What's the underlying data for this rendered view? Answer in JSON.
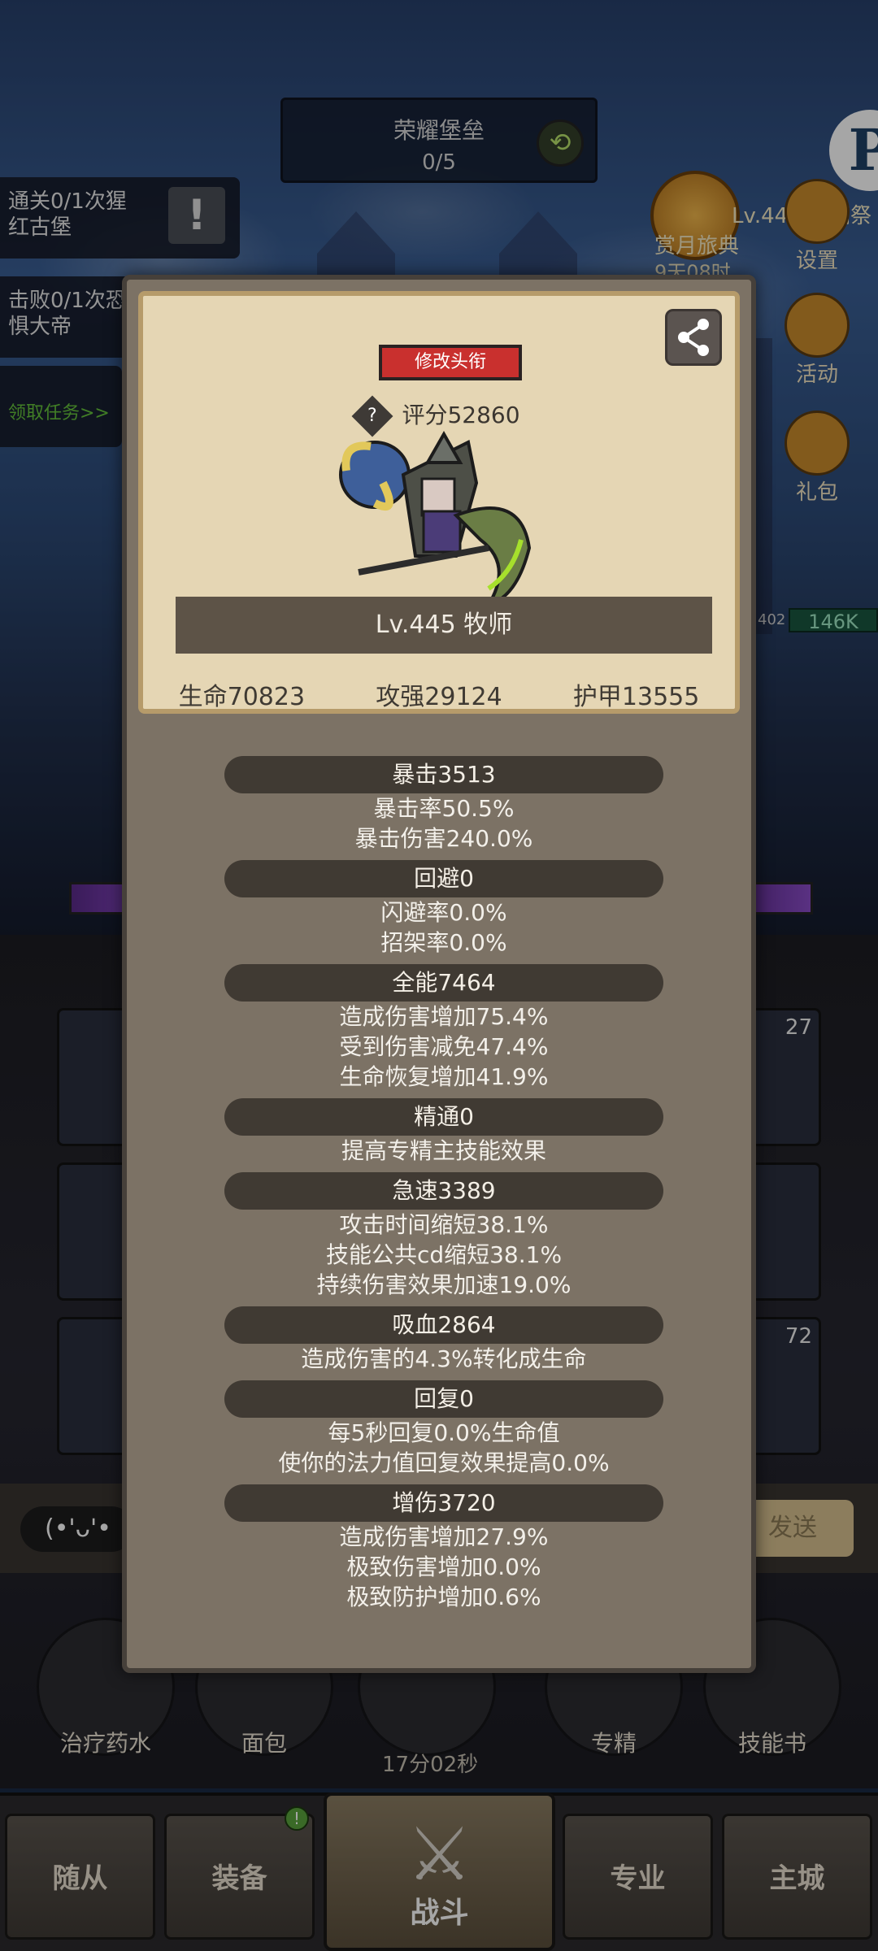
{
  "background": {
    "quest_top": {
      "title": "荣耀堡垒",
      "progress": "0/5"
    },
    "tasks": [
      {
        "line1": "通关0/1次猩",
        "line2": "红古堡"
      },
      {
        "line1": "击败0/1次恐",
        "line2": "惧大帝"
      }
    ],
    "task_link": "领取任务>>",
    "right_menu": [
      "设置",
      "活动",
      "礼包"
    ],
    "event": {
      "lv": "Lv.445 萨满祭",
      "name": "赏月旅典",
      "time": "9天08时"
    },
    "corner_logo": "P",
    "hp_badge": "146K",
    "hp_small": "402",
    "slot_numbers": [
      "27",
      "72"
    ],
    "chat": {
      "emoji": "(•'ᴗ'•",
      "send": "发送"
    },
    "items": [
      "治疗药水",
      "面包",
      "专精",
      "技能书"
    ],
    "timer": "17分02秒",
    "nav": [
      "随从",
      "装备",
      "战斗",
      "专业",
      "主城"
    ],
    "nav_badge": "!"
  },
  "modal": {
    "title_button": "修改头衔",
    "score": "评分52860",
    "help": "?",
    "hero_name": "Lv.445 牧师",
    "base_stats": [
      "生命70823",
      "攻强29124",
      "护甲13555"
    ],
    "stat_groups": [
      {
        "head": "暴击3513",
        "lines": [
          "暴击率50.5%",
          "暴击伤害240.0%"
        ]
      },
      {
        "head": "回避0",
        "lines": [
          "闪避率0.0%",
          "招架率0.0%"
        ]
      },
      {
        "head": "全能7464",
        "lines": [
          "造成伤害增加75.4%",
          "受到伤害减免47.4%",
          "生命恢复增加41.9%"
        ]
      },
      {
        "head": "精通0",
        "lines": [
          "提高专精主技能效果"
        ]
      },
      {
        "head": "急速3389",
        "lines": [
          "攻击时间缩短38.1%",
          "技能公共cd缩短38.1%",
          "持续伤害效果加速19.0%"
        ]
      },
      {
        "head": "吸血2864",
        "lines": [
          "造成伤害的4.3%转化成生命"
        ]
      },
      {
        "head": "回复0",
        "lines": [
          "每5秒回复0.0%生命值",
          "使你的法力值回复效果提高0.0%"
        ]
      },
      {
        "head": "增伤3720",
        "lines": [
          "造成伤害增加27.9%",
          "极致伤害增加0.0%",
          "极致防护增加0.6%"
        ]
      }
    ]
  }
}
